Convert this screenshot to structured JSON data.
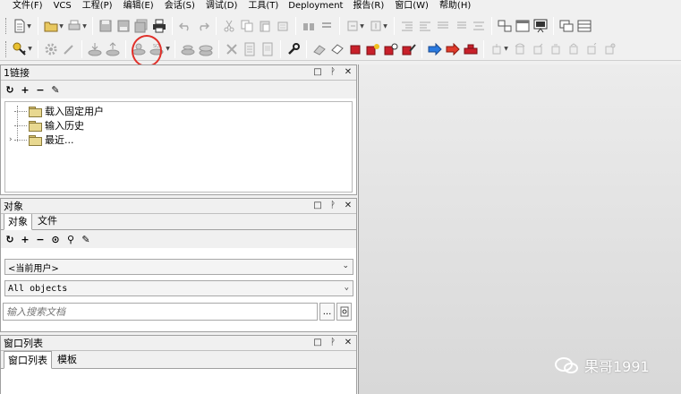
{
  "menu": [
    "文件(F)",
    "VCS",
    "工程(P)",
    "编辑(E)",
    "会话(S)",
    "调试(D)",
    "工具(T)",
    "Deployment",
    "报告(R)",
    "窗口(W)",
    "帮助(H)"
  ],
  "panels": {
    "connections": {
      "title": "1链接",
      "tree": [
        "载入固定用户",
        "输入历史",
        "最近..."
      ]
    },
    "objects": {
      "title": "对象",
      "tabs": [
        "对象",
        "文件"
      ],
      "user_select": "<当前用户>",
      "type_select": "All objects",
      "search_placeholder": "输入搜索文档",
      "browse_button": "..."
    },
    "windows": {
      "title": "窗口列表",
      "tabs": [
        "窗口列表",
        "模板"
      ]
    }
  },
  "watermark": "果哥1991",
  "colors": {
    "highlight": "#e0302a",
    "run_blue": "#2a7ae0",
    "run_red": "#e03a2a"
  }
}
